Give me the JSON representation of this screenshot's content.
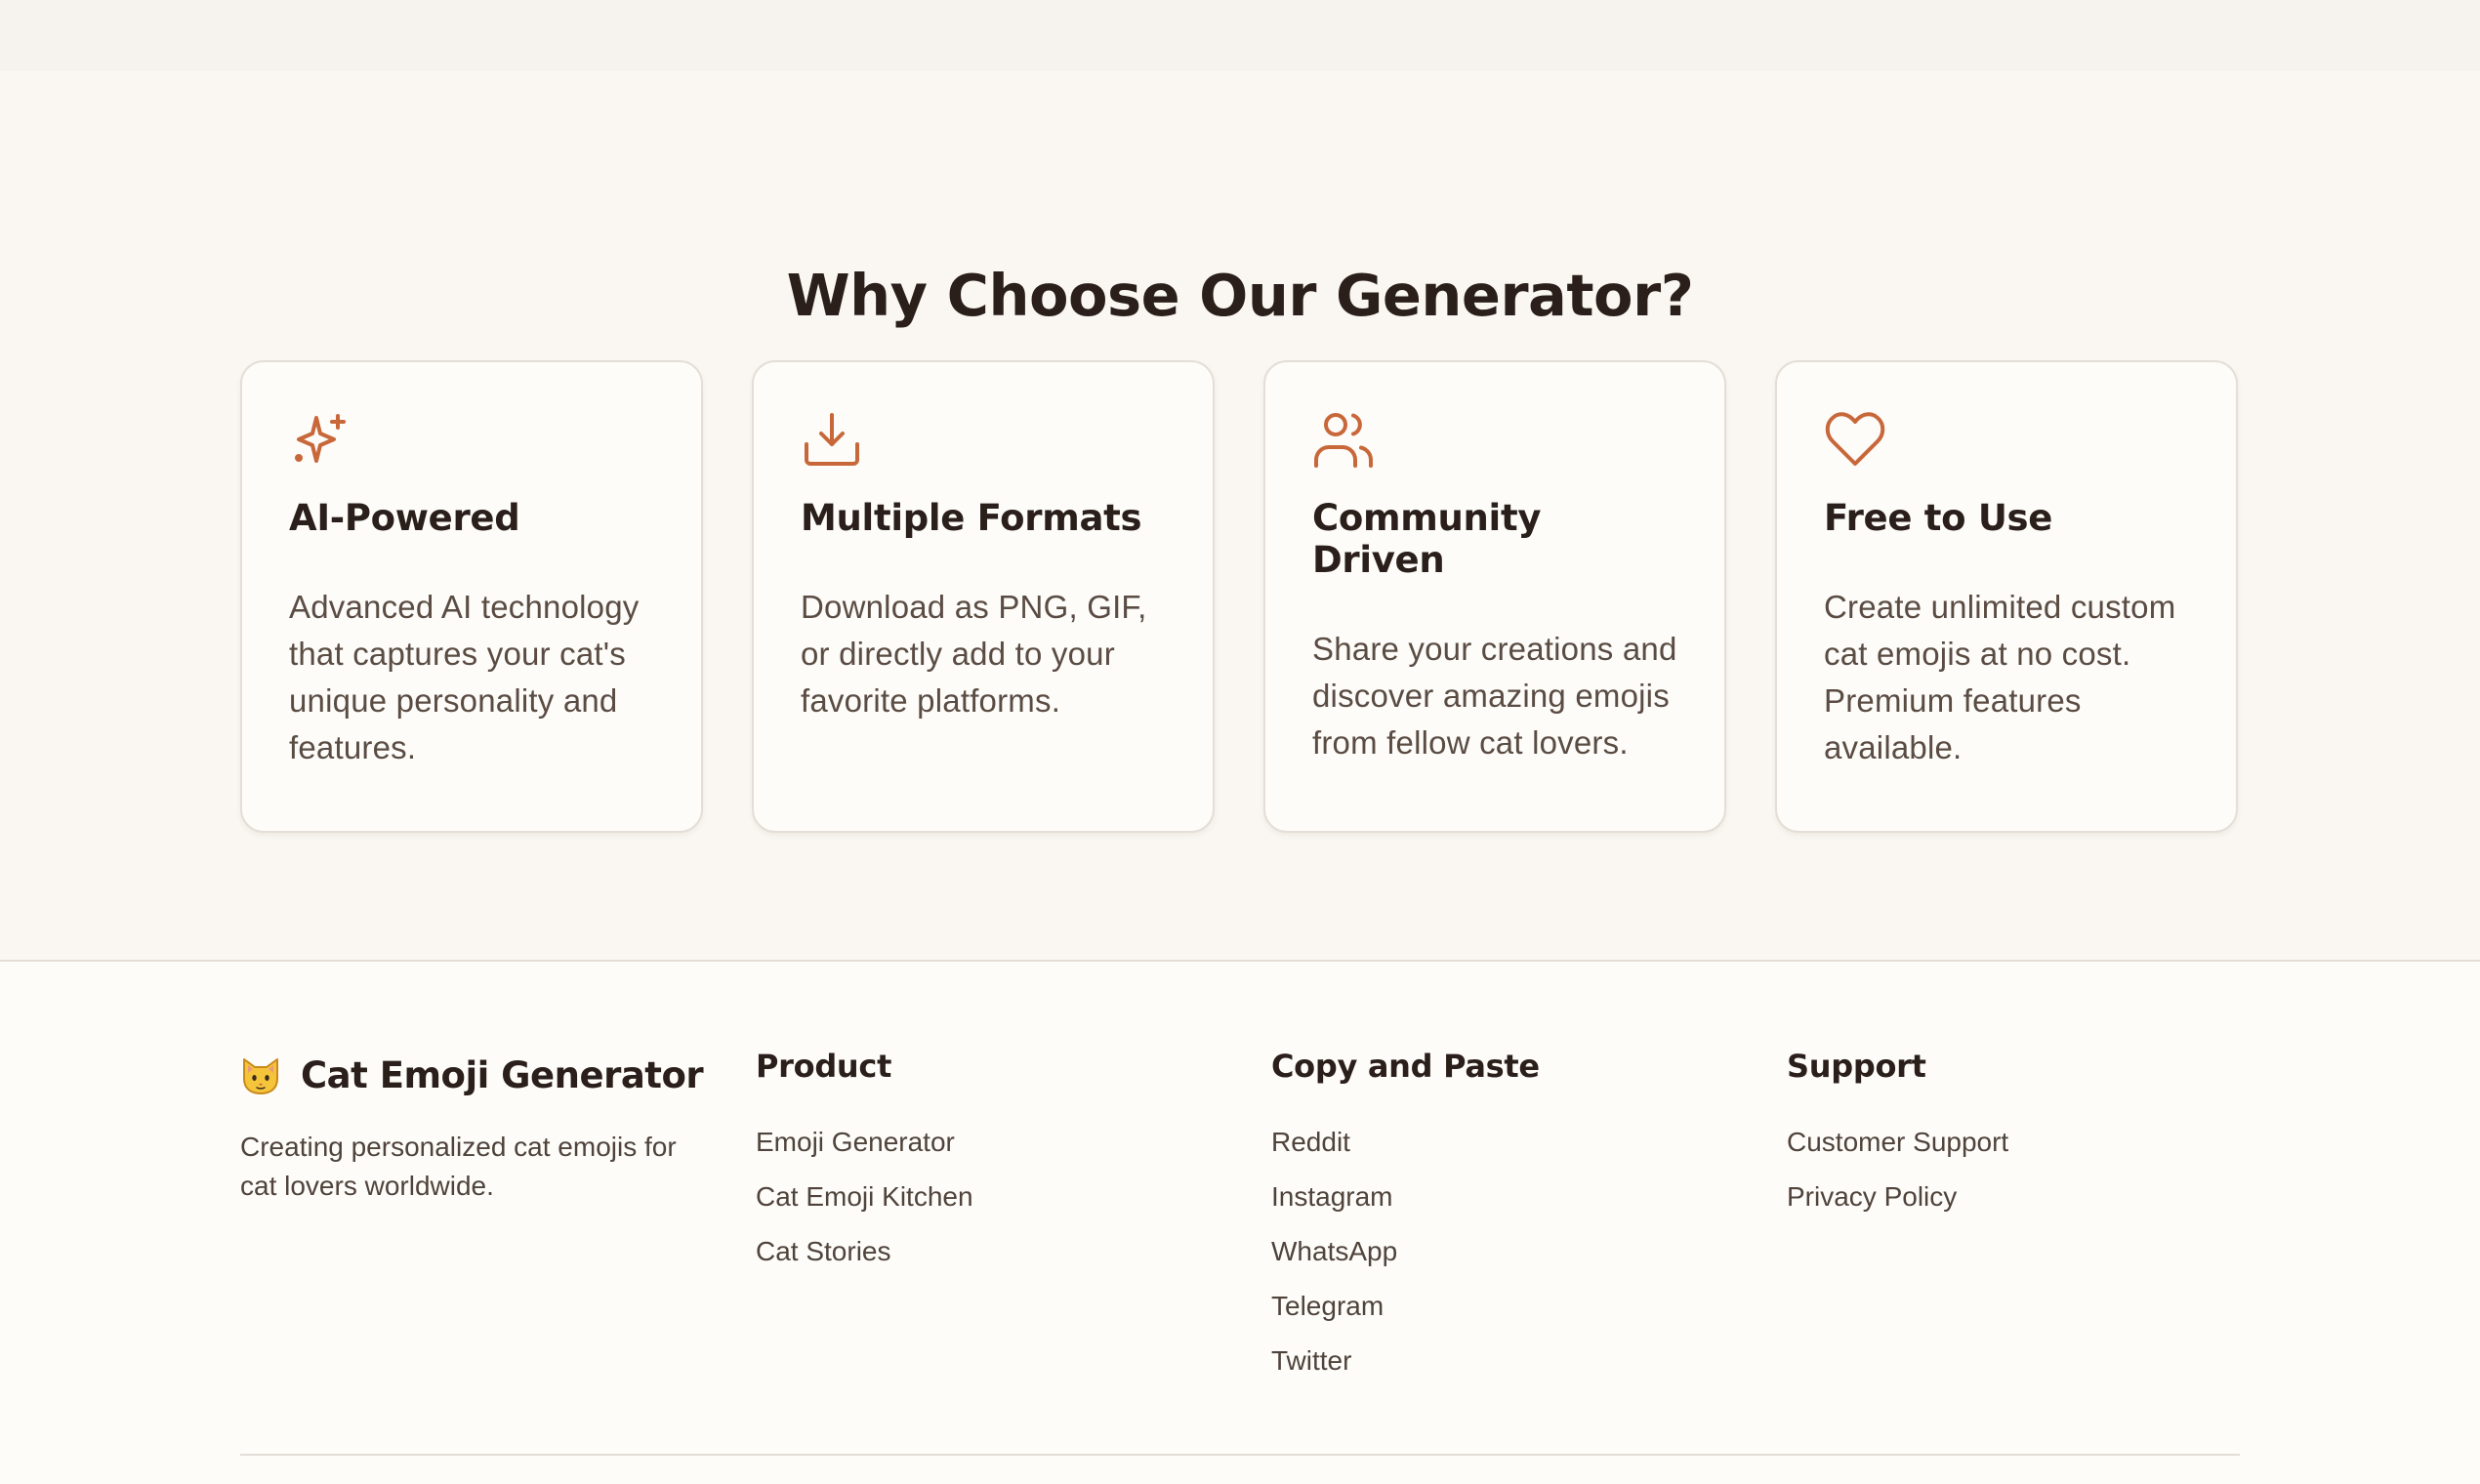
{
  "features": {
    "title": "Why Choose Our Generator?",
    "accent_color": "#c8683a",
    "cards": [
      {
        "icon": "sparkles-icon",
        "title": "AI-Powered",
        "description": "Advanced AI technology that captures your cat's unique personality and features."
      },
      {
        "icon": "download-icon",
        "title": "Multiple Formats",
        "description": "Download as PNG, GIF, or directly add to your favorite platforms."
      },
      {
        "icon": "users-icon",
        "title": "Community Driven",
        "description": "Share your creations and discover amazing emojis from fellow cat lovers."
      },
      {
        "icon": "heart-icon",
        "title": "Free to Use",
        "description": "Create unlimited custom cat emojis at no cost. Premium features available."
      }
    ]
  },
  "footer": {
    "brand": {
      "icon": "cat-face-icon",
      "name": "Cat Emoji Generator",
      "tagline": "Creating personalized cat emojis for cat lovers worldwide."
    },
    "columns": [
      {
        "heading": "Product",
        "links": [
          "Emoji Generator",
          "Cat Emoji Kitchen",
          "Cat Stories"
        ]
      },
      {
        "heading": "Copy and Paste",
        "links": [
          "Reddit",
          "Instagram",
          "WhatsApp",
          "Telegram",
          "Twitter"
        ]
      },
      {
        "heading": "Support",
        "links": [
          "Customer Support",
          "Privacy Policy"
        ]
      }
    ]
  }
}
